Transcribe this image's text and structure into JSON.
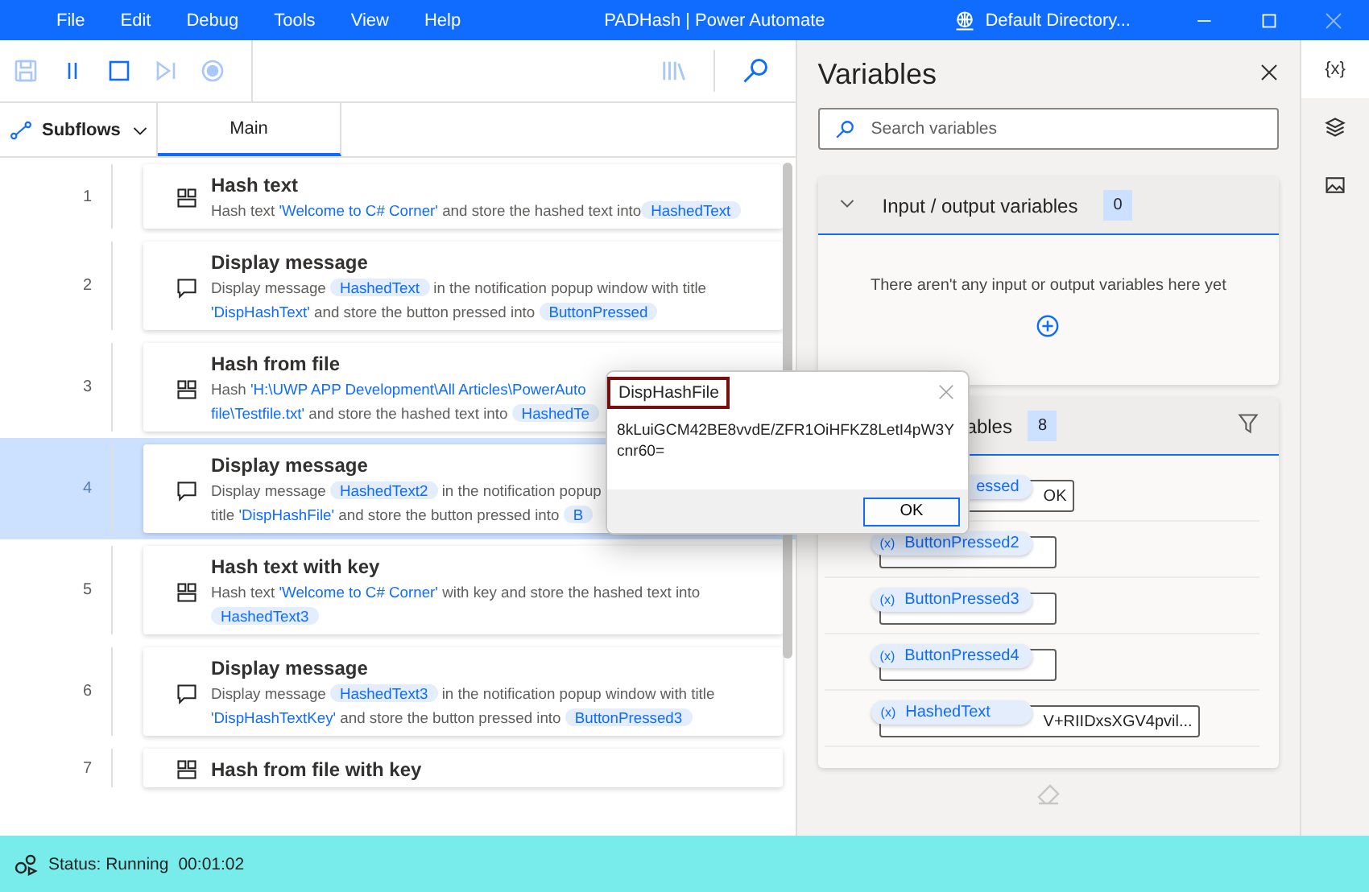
{
  "window": {
    "menus": [
      "File",
      "Edit",
      "Debug",
      "Tools",
      "View",
      "Help"
    ],
    "title": "PADHash | Power Automate",
    "account": "Default Directory..."
  },
  "toolbar": {
    "buttons": [
      {
        "kind": "save",
        "disabled": true
      },
      {
        "kind": "pause",
        "disabled": false
      },
      {
        "kind": "stop",
        "disabled": false
      },
      {
        "kind": "step",
        "disabled": true
      },
      {
        "kind": "record",
        "disabled": true
      }
    ],
    "right_buttons": [
      {
        "kind": "recorder",
        "disabled": true
      },
      {
        "kind": "search",
        "disabled": false
      }
    ]
  },
  "subflows": {
    "label": "Subflows"
  },
  "tabs": [
    {
      "label": "Main",
      "selected": true
    }
  ],
  "steps": [
    {
      "number": "1",
      "kind": "hash",
      "title": "Hash text",
      "selected": false,
      "description": [
        {
          "kind": "text",
          "text": "Hash text "
        },
        {
          "kind": "literal",
          "text": "'Welcome to C# Corner'"
        },
        {
          "kind": "text",
          "text": " and store the hashed text into"
        },
        {
          "kind": "var",
          "text": "HashedText"
        }
      ]
    },
    {
      "number": "2",
      "kind": "message",
      "title": "Display message",
      "selected": false,
      "description": [
        {
          "kind": "text",
          "text": "Display message "
        },
        {
          "kind": "var",
          "text": "HashedText"
        },
        {
          "kind": "text",
          "text": " in the notification popup window with title "
        },
        {
          "kind": "literal",
          "text": "'DispHashText'"
        },
        {
          "kind": "text",
          "text": " and store the button pressed into "
        },
        {
          "kind": "var",
          "text": "ButtonPressed"
        }
      ]
    },
    {
      "number": "3",
      "kind": "hash",
      "title": "Hash from file",
      "selected": false,
      "description": [
        {
          "kind": "text",
          "text": "Hash "
        },
        {
          "kind": "literal",
          "text": "'H:\\UWP APP Development\\All Articles\\PowerAuto"
        },
        {
          "kind": "break"
        },
        {
          "kind": "literal",
          "text": "file\\Testfile.txt'"
        },
        {
          "kind": "text",
          "text": " and store the hashed text into "
        },
        {
          "kind": "var",
          "text": "HashedTe"
        }
      ]
    },
    {
      "number": "4",
      "kind": "message",
      "title": "Display message",
      "selected": true,
      "description": [
        {
          "kind": "text",
          "text": "Display message "
        },
        {
          "kind": "var",
          "text": "HashedText2"
        },
        {
          "kind": "text",
          "text": " in the notification popup"
        },
        {
          "kind": "break"
        },
        {
          "kind": "text",
          "text": "title "
        },
        {
          "kind": "literal",
          "text": "'DispHashFile'"
        },
        {
          "kind": "text",
          "text": " and store the button pressed into "
        },
        {
          "kind": "var",
          "text": "B"
        }
      ]
    },
    {
      "number": "5",
      "kind": "hash",
      "title": "Hash text with key",
      "selected": false,
      "description": [
        {
          "kind": "text",
          "text": "Hash text "
        },
        {
          "kind": "literal",
          "text": "'Welcome to C# Corner'"
        },
        {
          "kind": "text",
          "text": " with key and store the hashed text into "
        },
        {
          "kind": "var",
          "text": "HashedText3"
        }
      ]
    },
    {
      "number": "6",
      "kind": "message",
      "title": "Display message",
      "selected": false,
      "description": [
        {
          "kind": "text",
          "text": "Display message "
        },
        {
          "kind": "var",
          "text": "HashedText3"
        },
        {
          "kind": "text",
          "text": " in the notification popup window with title "
        },
        {
          "kind": "literal",
          "text": "'DispHashTextKey'"
        },
        {
          "kind": "text",
          "text": " and store the button pressed into "
        },
        {
          "kind": "var",
          "text": "ButtonPressed3"
        }
      ]
    },
    {
      "number": "7",
      "kind": "hash",
      "title": "Hash from file with key",
      "selected": false
    }
  ],
  "variables": {
    "title": "Variables",
    "search": {
      "placeholder": "Search variables"
    },
    "io": {
      "title": "Input / output variables",
      "count": "0",
      "expanded": true,
      "empty_message": "There aren't any input or output variables here yet"
    },
    "flow": {
      "title": "ables",
      "count": "8",
      "items": [
        {
          "name": "essed",
          "value": "OK"
        },
        {
          "icon": "(x)",
          "name": "ButtonPressed2"
        },
        {
          "icon": "(x)",
          "name": "ButtonPressed3"
        },
        {
          "icon": "(x)",
          "name": "ButtonPressed4"
        },
        {
          "icon": "(x)",
          "name": "HashedText",
          "value": "V+RIIDxsXGV4pvil..."
        }
      ]
    }
  },
  "rail": [
    {
      "kind": "variables",
      "label": "{x}",
      "selected": true
    },
    {
      "kind": "layers",
      "selected": false
    },
    {
      "kind": "images",
      "selected": false
    }
  ],
  "dialog": {
    "title": "DispHashFile",
    "message": "8kLuiGCM42BE8vvdE/ZFR1OiHFKZ8LetI4pW3Ycnr60=",
    "buttons": [
      "OK"
    ]
  },
  "status_bar": {
    "status": "Status: Running",
    "time": "00:01:02"
  }
}
